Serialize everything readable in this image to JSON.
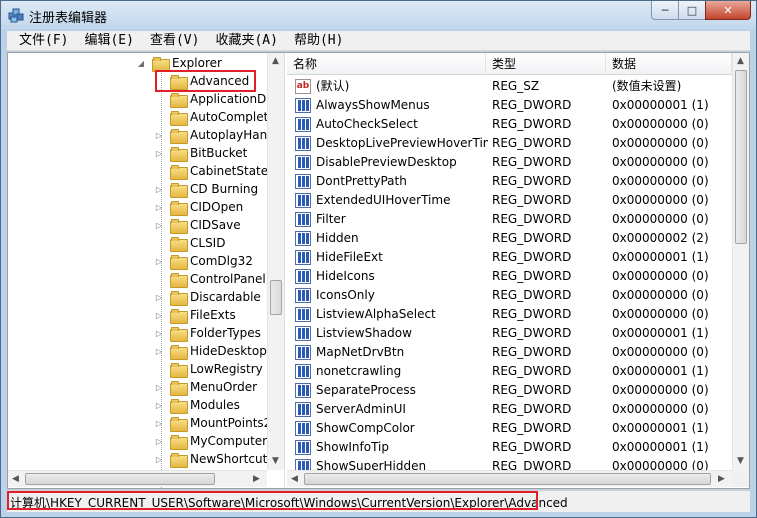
{
  "window": {
    "title": "注册表编辑器",
    "minimize_glyph": "─",
    "maximize_glyph": "□",
    "close_glyph": "✕"
  },
  "menu": [
    "文件(F)",
    "编辑(E)",
    "查看(V)",
    "收藏夹(A)",
    "帮助(H)"
  ],
  "tree": {
    "parent": "Explorer",
    "selected": "Advanced",
    "children": [
      "Advanced",
      "ApplicationDe",
      "AutoComplete",
      "AutoplayHand",
      "BitBucket",
      "CabinetState",
      "CD Burning",
      "CIDOpen",
      "CIDSave",
      "CLSID",
      "ComDlg32",
      "ControlPanel",
      "Discardable",
      "FileExts",
      "FolderTypes",
      "HideDesktopIc",
      "LowRegistry",
      "MenuOrder",
      "Modules",
      "MountPoints2",
      "MyComputer",
      "NewShortcutH"
    ],
    "expandable": [
      false,
      false,
      false,
      true,
      true,
      false,
      true,
      true,
      true,
      false,
      true,
      false,
      true,
      true,
      true,
      true,
      false,
      true,
      true,
      true,
      true,
      true
    ]
  },
  "list": {
    "columns": [
      "名称",
      "类型",
      "数据"
    ],
    "rows": [
      {
        "icon": "string-value-icon",
        "name": "(默认)",
        "type": "REG_SZ",
        "data": "(数值未设置)"
      },
      {
        "icon": "dword-value-icon",
        "name": "AlwaysShowMenus",
        "type": "REG_DWORD",
        "data": "0x00000001 (1)"
      },
      {
        "icon": "dword-value-icon",
        "name": "AutoCheckSelect",
        "type": "REG_DWORD",
        "data": "0x00000000 (0)"
      },
      {
        "icon": "dword-value-icon",
        "name": "DesktopLivePreviewHoverTime",
        "type": "REG_DWORD",
        "data": "0x00000000 (0)"
      },
      {
        "icon": "dword-value-icon",
        "name": "DisablePreviewDesktop",
        "type": "REG_DWORD",
        "data": "0x00000000 (0)"
      },
      {
        "icon": "dword-value-icon",
        "name": "DontPrettyPath",
        "type": "REG_DWORD",
        "data": "0x00000000 (0)"
      },
      {
        "icon": "dword-value-icon",
        "name": "ExtendedUIHoverTime",
        "type": "REG_DWORD",
        "data": "0x00000000 (0)"
      },
      {
        "icon": "dword-value-icon",
        "name": "Filter",
        "type": "REG_DWORD",
        "data": "0x00000000 (0)"
      },
      {
        "icon": "dword-value-icon",
        "name": "Hidden",
        "type": "REG_DWORD",
        "data": "0x00000002 (2)"
      },
      {
        "icon": "dword-value-icon",
        "name": "HideFileExt",
        "type": "REG_DWORD",
        "data": "0x00000001 (1)"
      },
      {
        "icon": "dword-value-icon",
        "name": "HideIcons",
        "type": "REG_DWORD",
        "data": "0x00000000 (0)"
      },
      {
        "icon": "dword-value-icon",
        "name": "IconsOnly",
        "type": "REG_DWORD",
        "data": "0x00000000 (0)"
      },
      {
        "icon": "dword-value-icon",
        "name": "ListviewAlphaSelect",
        "type": "REG_DWORD",
        "data": "0x00000000 (0)"
      },
      {
        "icon": "dword-value-icon",
        "name": "ListviewShadow",
        "type": "REG_DWORD",
        "data": "0x00000001 (1)"
      },
      {
        "icon": "dword-value-icon",
        "name": "MapNetDrvBtn",
        "type": "REG_DWORD",
        "data": "0x00000000 (0)"
      },
      {
        "icon": "dword-value-icon",
        "name": "nonetcrawling",
        "type": "REG_DWORD",
        "data": "0x00000001 (1)"
      },
      {
        "icon": "dword-value-icon",
        "name": "SeparateProcess",
        "type": "REG_DWORD",
        "data": "0x00000000 (0)"
      },
      {
        "icon": "dword-value-icon",
        "name": "ServerAdminUI",
        "type": "REG_DWORD",
        "data": "0x00000000 (0)"
      },
      {
        "icon": "dword-value-icon",
        "name": "ShowCompColor",
        "type": "REG_DWORD",
        "data": "0x00000001 (1)"
      },
      {
        "icon": "dword-value-icon",
        "name": "ShowInfoTip",
        "type": "REG_DWORD",
        "data": "0x00000001 (1)"
      },
      {
        "icon": "dword-value-icon",
        "name": "ShowSuperHidden",
        "type": "REG_DWORD",
        "data": "0x00000000 (0)"
      }
    ]
  },
  "status": {
    "path": "计算机\\HKEY_CURRENT_USER\\Software\\Microsoft\\Windows\\CurrentVersion\\Explorer\\Advanced"
  },
  "colors": {
    "highlight": "#e0202a",
    "frame": "#bcd2e8",
    "dword_icon": "#2c5bb7",
    "string_icon": "#c0281e"
  }
}
